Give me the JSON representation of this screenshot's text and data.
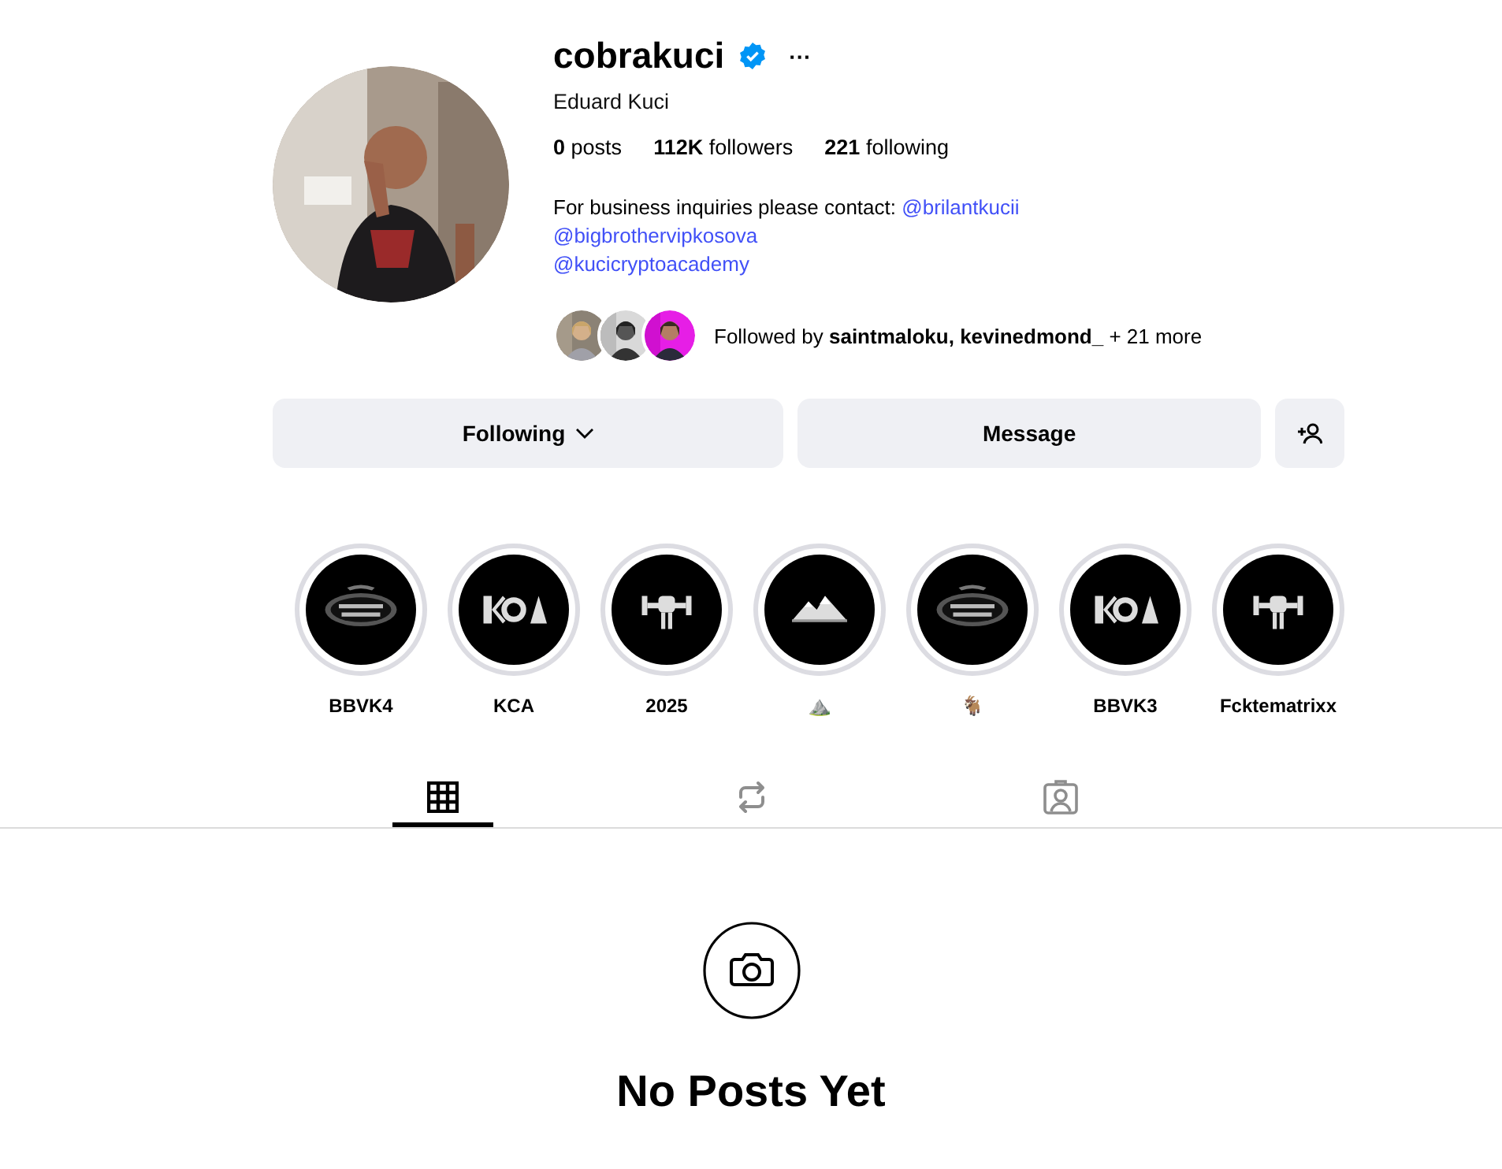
{
  "profile": {
    "username": "cobrakuci",
    "verified": true,
    "more": "···",
    "full_name": "Eduard Kuci",
    "stats": [
      {
        "count": "0",
        "label": "posts"
      },
      {
        "count": "112K",
        "label": "followers"
      },
      {
        "count": "221",
        "label": "following"
      }
    ],
    "bio": {
      "text": "For business inquiries please contact:",
      "links": [
        "@brilantkucii",
        "@bigbrothervipkosova",
        "@kucicryptoacademy"
      ]
    },
    "followed_by": "Followed by **saintmaloku, kevinedmond_** + 21 more"
  },
  "actions": {
    "follow": "Following",
    "message": "Message"
  },
  "highlights": [
    {
      "label": "BBVK4"
    },
    {
      "label": "KCA"
    },
    {
      "label": "2025"
    },
    {
      "label": "⛰️"
    },
    {
      "label": "🐐"
    },
    {
      "label": "BBVK3"
    },
    {
      "label": "Fcktematrixx"
    }
  ],
  "tabs": [
    {
      "kind": "grid",
      "selected": true
    },
    {
      "kind": "reposts",
      "selected": false
    },
    {
      "kind": "tagged",
      "selected": false
    }
  ],
  "empty": {
    "title": "No Posts Yet"
  }
}
